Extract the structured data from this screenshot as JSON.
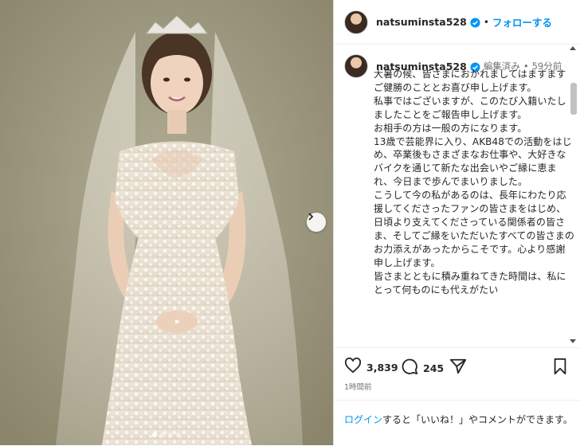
{
  "post": {
    "username": "natsuminsta528",
    "follow_label": "フォローする",
    "separator": "•",
    "edited_label": "編集済み",
    "meta_separator": "•",
    "time_ago": "59分前",
    "caption_paragraphs": [
      "大暑の候、皆さまにおかれましてはますますご健勝のこととお喜び申し上げます。",
      "私事ではございますが、このたび入籍いたしましたことをご報告申し上げます。",
      "お相手の方は一般の方になります。",
      "13歳で芸能界に入り、AKB48での活動をはじめ、卒業後もさまざまなお仕事や、大好きなバイクを通じて新たな出会いやご縁に恵まれ、今日まで歩んでまいりました。",
      "こうして今の私があるのは、長年にわたり応援してくださったファンの皆さまをはじめ、日頃より支えてくださっている関係者の皆さま、そしてご縁をいただいたすべての皆さまのお力添えがあったからこそです。心より感謝申し上げます。",
      "皆さまとともに積み重ねてきた時間は、私にとって何ものにも代えがたい"
    ],
    "likes": "3,839",
    "comments": "245",
    "posted_time": "1時間前",
    "login_link": "ログイン",
    "login_suffix": "すると「いいね！」やコメントができます。"
  },
  "carousel": {
    "total": 4,
    "active_index": 0
  },
  "icons": {
    "verified": "verified-badge-icon",
    "like": "heart-icon",
    "comment": "comment-bubble-icon",
    "share": "paper-plane-icon",
    "save": "bookmark-icon",
    "next": "chevron-right-icon"
  },
  "colors": {
    "link": "#0095f6",
    "text": "#262626",
    "muted": "#737373",
    "verified": "#0095f6"
  }
}
